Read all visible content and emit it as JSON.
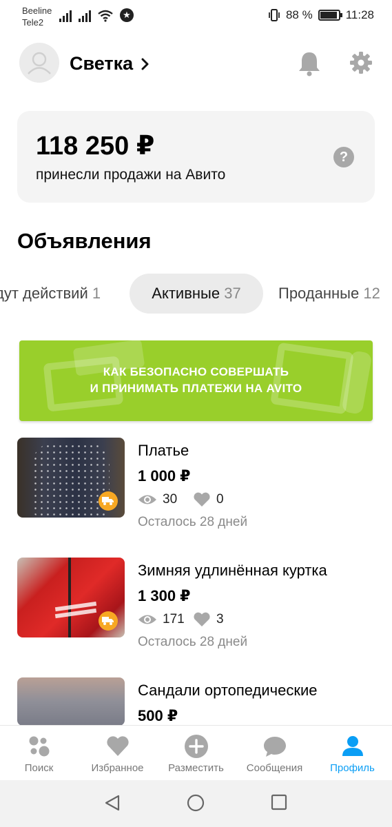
{
  "status_bar": {
    "carrier1": "Beeline",
    "carrier2": "Tele2",
    "battery": "88 %",
    "time": "11:28"
  },
  "header": {
    "username": "Светка",
    "icons": [
      "avatar-icon",
      "chevron-right-icon",
      "bell-icon",
      "gear-icon"
    ]
  },
  "earnings": {
    "amount": "118 250 ₽",
    "caption": "принесли продажи на Авито",
    "help_glyph": "?"
  },
  "section_title": "Объявления",
  "tabs": [
    {
      "label": "дут действий",
      "count": "1"
    },
    {
      "label": "Активные",
      "count": "37",
      "active": true
    },
    {
      "label": "Проданные",
      "count": "12"
    }
  ],
  "banner": {
    "line1": "КАК БЕЗОПАСНО СОВЕРШАТЬ",
    "line2": "И ПРИНИМАТЬ ПЛАТЕЖИ НА AVITO",
    "color": "#99cf2b"
  },
  "listings": [
    {
      "title": "Платье",
      "price": "1 000 ₽",
      "views": "30",
      "likes": "0",
      "remaining": "Осталось 28 дней",
      "delivery": true
    },
    {
      "title": "Зимняя удлинённая куртка",
      "price": "1 300 ₽",
      "views": "171",
      "likes": "3",
      "remaining": "Осталось 28 дней",
      "delivery": true
    },
    {
      "title": "Сандали ортопедические",
      "price": "500 ₽"
    }
  ],
  "bottom_nav": [
    {
      "label": "Поиск",
      "icon": "search-dots-icon"
    },
    {
      "label": "Избранное",
      "icon": "heart-icon"
    },
    {
      "label": "Разместить",
      "icon": "plus-circle-icon"
    },
    {
      "label": "Сообщения",
      "icon": "chat-bubble-icon"
    },
    {
      "label": "Профиль",
      "icon": "person-icon",
      "active": true
    }
  ],
  "colors": {
    "accent": "#0a9ef5",
    "delivery_badge": "#f7a823",
    "muted_text": "#8a8a8a"
  }
}
